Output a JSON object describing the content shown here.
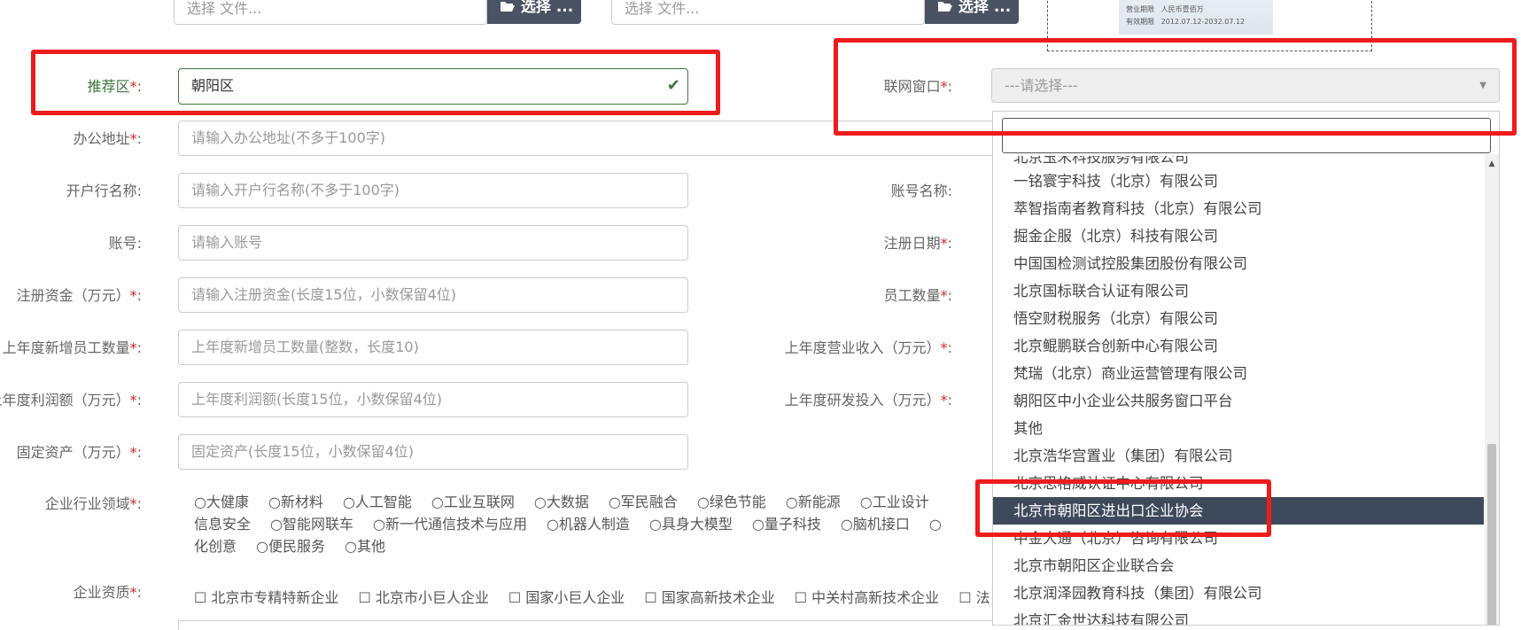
{
  "top_files": [
    {
      "placeholder": "选择 文件...",
      "button": "选择 ..."
    },
    {
      "placeholder": "选择 文件...",
      "button": "选择 ..."
    }
  ],
  "license_image": {
    "line1_label": "营业期限",
    "line1_value": "人民币壹佰万",
    "line2_label": "有效期限",
    "line2_value": "2012.07.12-2032.07.12"
  },
  "recommend": {
    "label": "推荐区",
    "value": "朝阳区"
  },
  "window": {
    "label": "联网窗口",
    "placeholder": "---请选择---"
  },
  "left_fields": [
    {
      "label": "办公地址",
      "required": true,
      "placeholder": "请输入办公地址(不多于100字)"
    },
    {
      "label": "开户行名称:",
      "required": false,
      "placeholder": "请输入开户行名称(不多于100字)"
    },
    {
      "label": "账号:",
      "required": false,
      "placeholder": "请输入账号"
    },
    {
      "label": "注册资金（万元）",
      "required": true,
      "placeholder": "请输入注册资金(长度15位，小数保留4位)"
    },
    {
      "label": "上年度新增员工数量",
      "required": true,
      "placeholder": "上年度新增员工数量(整数，长度10)"
    },
    {
      "label": "上年度利润额（万元）",
      "required": true,
      "placeholder": "上年度利润额(长度15位，小数保留4位)"
    },
    {
      "label": "固定资产（万元）",
      "required": true,
      "placeholder": "固定资产(长度15位，小数保留4位)"
    }
  ],
  "right_labels": [
    {
      "label": "账号名称:",
      "required": false
    },
    {
      "label": "注册日期",
      "required": true
    },
    {
      "label": "员工数量",
      "required": true
    },
    {
      "label": "上年度营业收入（万元）",
      "required": true
    },
    {
      "label": "上年度研发投入（万元）",
      "required": true
    }
  ],
  "industry": {
    "label": "企业行业领域",
    "row1": [
      "○大健康",
      "○新材料",
      "○人工智能",
      "○工业互联网",
      "○大数据",
      "○军民融合",
      "○绿色节能",
      "○新能源",
      "○工业设计"
    ],
    "row2": [
      "信息安全",
      "○智能网联车",
      "○新一代通信技术与应用",
      "○机器人制造",
      "○具身大模型",
      "○量子科技",
      "○脑机接口",
      "○"
    ],
    "row3": [
      "化创意",
      "○便民服务",
      "○其他"
    ]
  },
  "qualification": {
    "label": "企业资质",
    "items": [
      "☐ 北京市专精特新企业",
      "☐ 北京市小巨人企业",
      "☐ 国家小巨人企业",
      "☐ 国家高新技术企业",
      "☐ 中关村高新技术企业",
      "☐ 法"
    ]
  },
  "dropdown": {
    "partial_top": "北京玉禾科技服务有限公司",
    "items": [
      "一铭寰宇科技（北京）有限公司",
      "萃智指南者教育科技（北京）有限公司",
      "掘金企服（北京）科技有限公司",
      "中国国检测试控股集团股份有限公司",
      "北京国标联合认证有限公司",
      "悟空财税服务（北京）有限公司",
      "北京鲲鹏联合创新中心有限公司",
      "梵瑞（北京）商业运营管理有限公司",
      "朝阳区中小企业公共服务窗口平台",
      "其他",
      "北京浩华宫置业（集团）有限公司",
      "北京思格威认证中心有限公司",
      "北京市朝阳区进出口企业协会",
      "中金大通（北京）咨询有限公司",
      "北京市朝阳区企业联合会",
      "北京润泽园教育科技（集团）有限公司",
      "北京汇金世达科技有限公司"
    ],
    "selected": "北京市朝阳区进出口企业协会"
  },
  "colors": {
    "highlight": "#ee1c1c",
    "success": "#3c763d",
    "selected_bg": "#3e4a5c"
  }
}
